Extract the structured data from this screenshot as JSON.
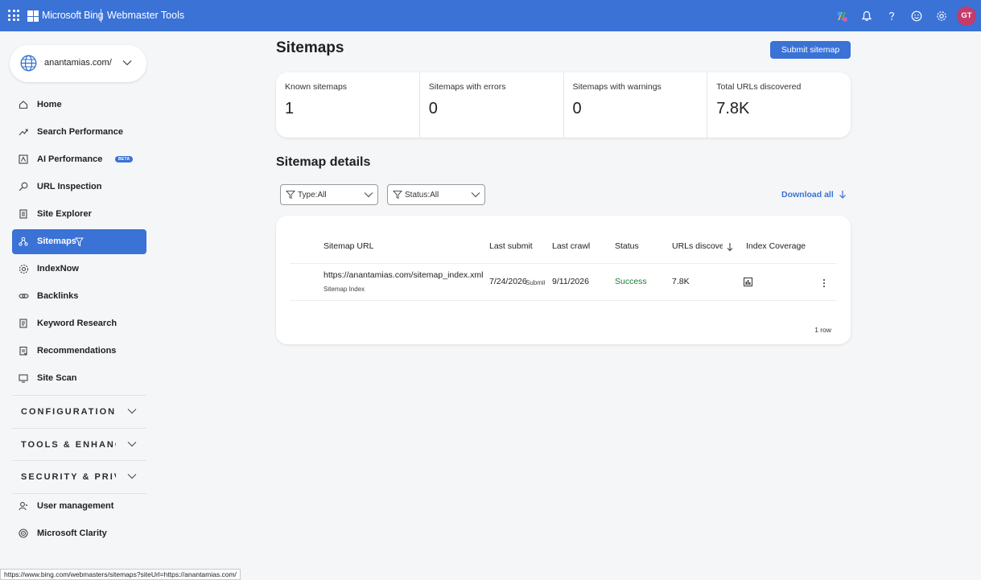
{
  "topbar": {
    "brand": "Microsoft Bing",
    "product": "Webmaster Tools",
    "avatar_initials": "GT",
    "icons": [
      "copilot-icon",
      "bell-icon",
      "help-icon",
      "feedback-smiley-icon",
      "settings-gear-icon"
    ]
  },
  "sidebar": {
    "site": "anantamias.com/",
    "items": [
      {
        "label": "Home",
        "icon": "home-icon"
      },
      {
        "label": "Search Performance",
        "icon": "trend-line-icon"
      },
      {
        "label": "AI Performance",
        "icon": "ai-box-icon",
        "badge": "BETA"
      },
      {
        "label": "URL Inspection",
        "icon": "magnifier-icon"
      },
      {
        "label": "Site Explorer",
        "icon": "document-icon"
      },
      {
        "label": "Sitemaps",
        "icon": "sitemap-icon",
        "active": true
      },
      {
        "label": "IndexNow",
        "icon": "gear-icon"
      },
      {
        "label": "Backlinks",
        "icon": "link-icon"
      },
      {
        "label": "Keyword Research",
        "icon": "document-icon"
      },
      {
        "label": "Recommendations",
        "icon": "clipboard-icon"
      },
      {
        "label": "Site Scan",
        "icon": "monitor-icon"
      }
    ],
    "sections": [
      "CONFIGURATION",
      "TOOLS & ENHANCEMENTS",
      "SECURITY & PRIVACY"
    ],
    "bottom_items": [
      {
        "label": "User management",
        "icon": "user-icon"
      },
      {
        "label": "Microsoft Clarity",
        "icon": "clarity-icon"
      }
    ]
  },
  "main": {
    "title": "Sitemaps",
    "submit_label": "Submit sitemap",
    "stats": [
      {
        "label": "Known sitemaps",
        "value": "1"
      },
      {
        "label": "Sitemaps with errors",
        "value": "0"
      },
      {
        "label": "Sitemaps with warnings",
        "value": "0"
      },
      {
        "label": "Total URLs discovered",
        "value": "7.8K"
      }
    ],
    "details_title": "Sitemap details",
    "filters": {
      "type": "Type:All",
      "status": "Status:All"
    },
    "download_label": "Download all",
    "table": {
      "columns": [
        "Sitemap URL",
        "Last submit",
        "Last crawl",
        "Status",
        "URLs discovered",
        "Index Coverage"
      ],
      "rows": [
        {
          "url": "https://anantamias.com/sitemap_index.xml",
          "type": "Sitemap Index",
          "last_submit": "7/24/2026",
          "last_submit_note": "Submitted",
          "last_crawl": "9/11/2026",
          "status": "Success",
          "urls_discovered": "7.8K"
        }
      ],
      "row_count": "1 row"
    }
  },
  "statusbar": {
    "url": "https://www.bing.com/webmasters/sitemaps?siteUrl=https://anantamias.com/"
  },
  "colors": {
    "accent": "#3a72d6",
    "success": "#1a7f37"
  }
}
